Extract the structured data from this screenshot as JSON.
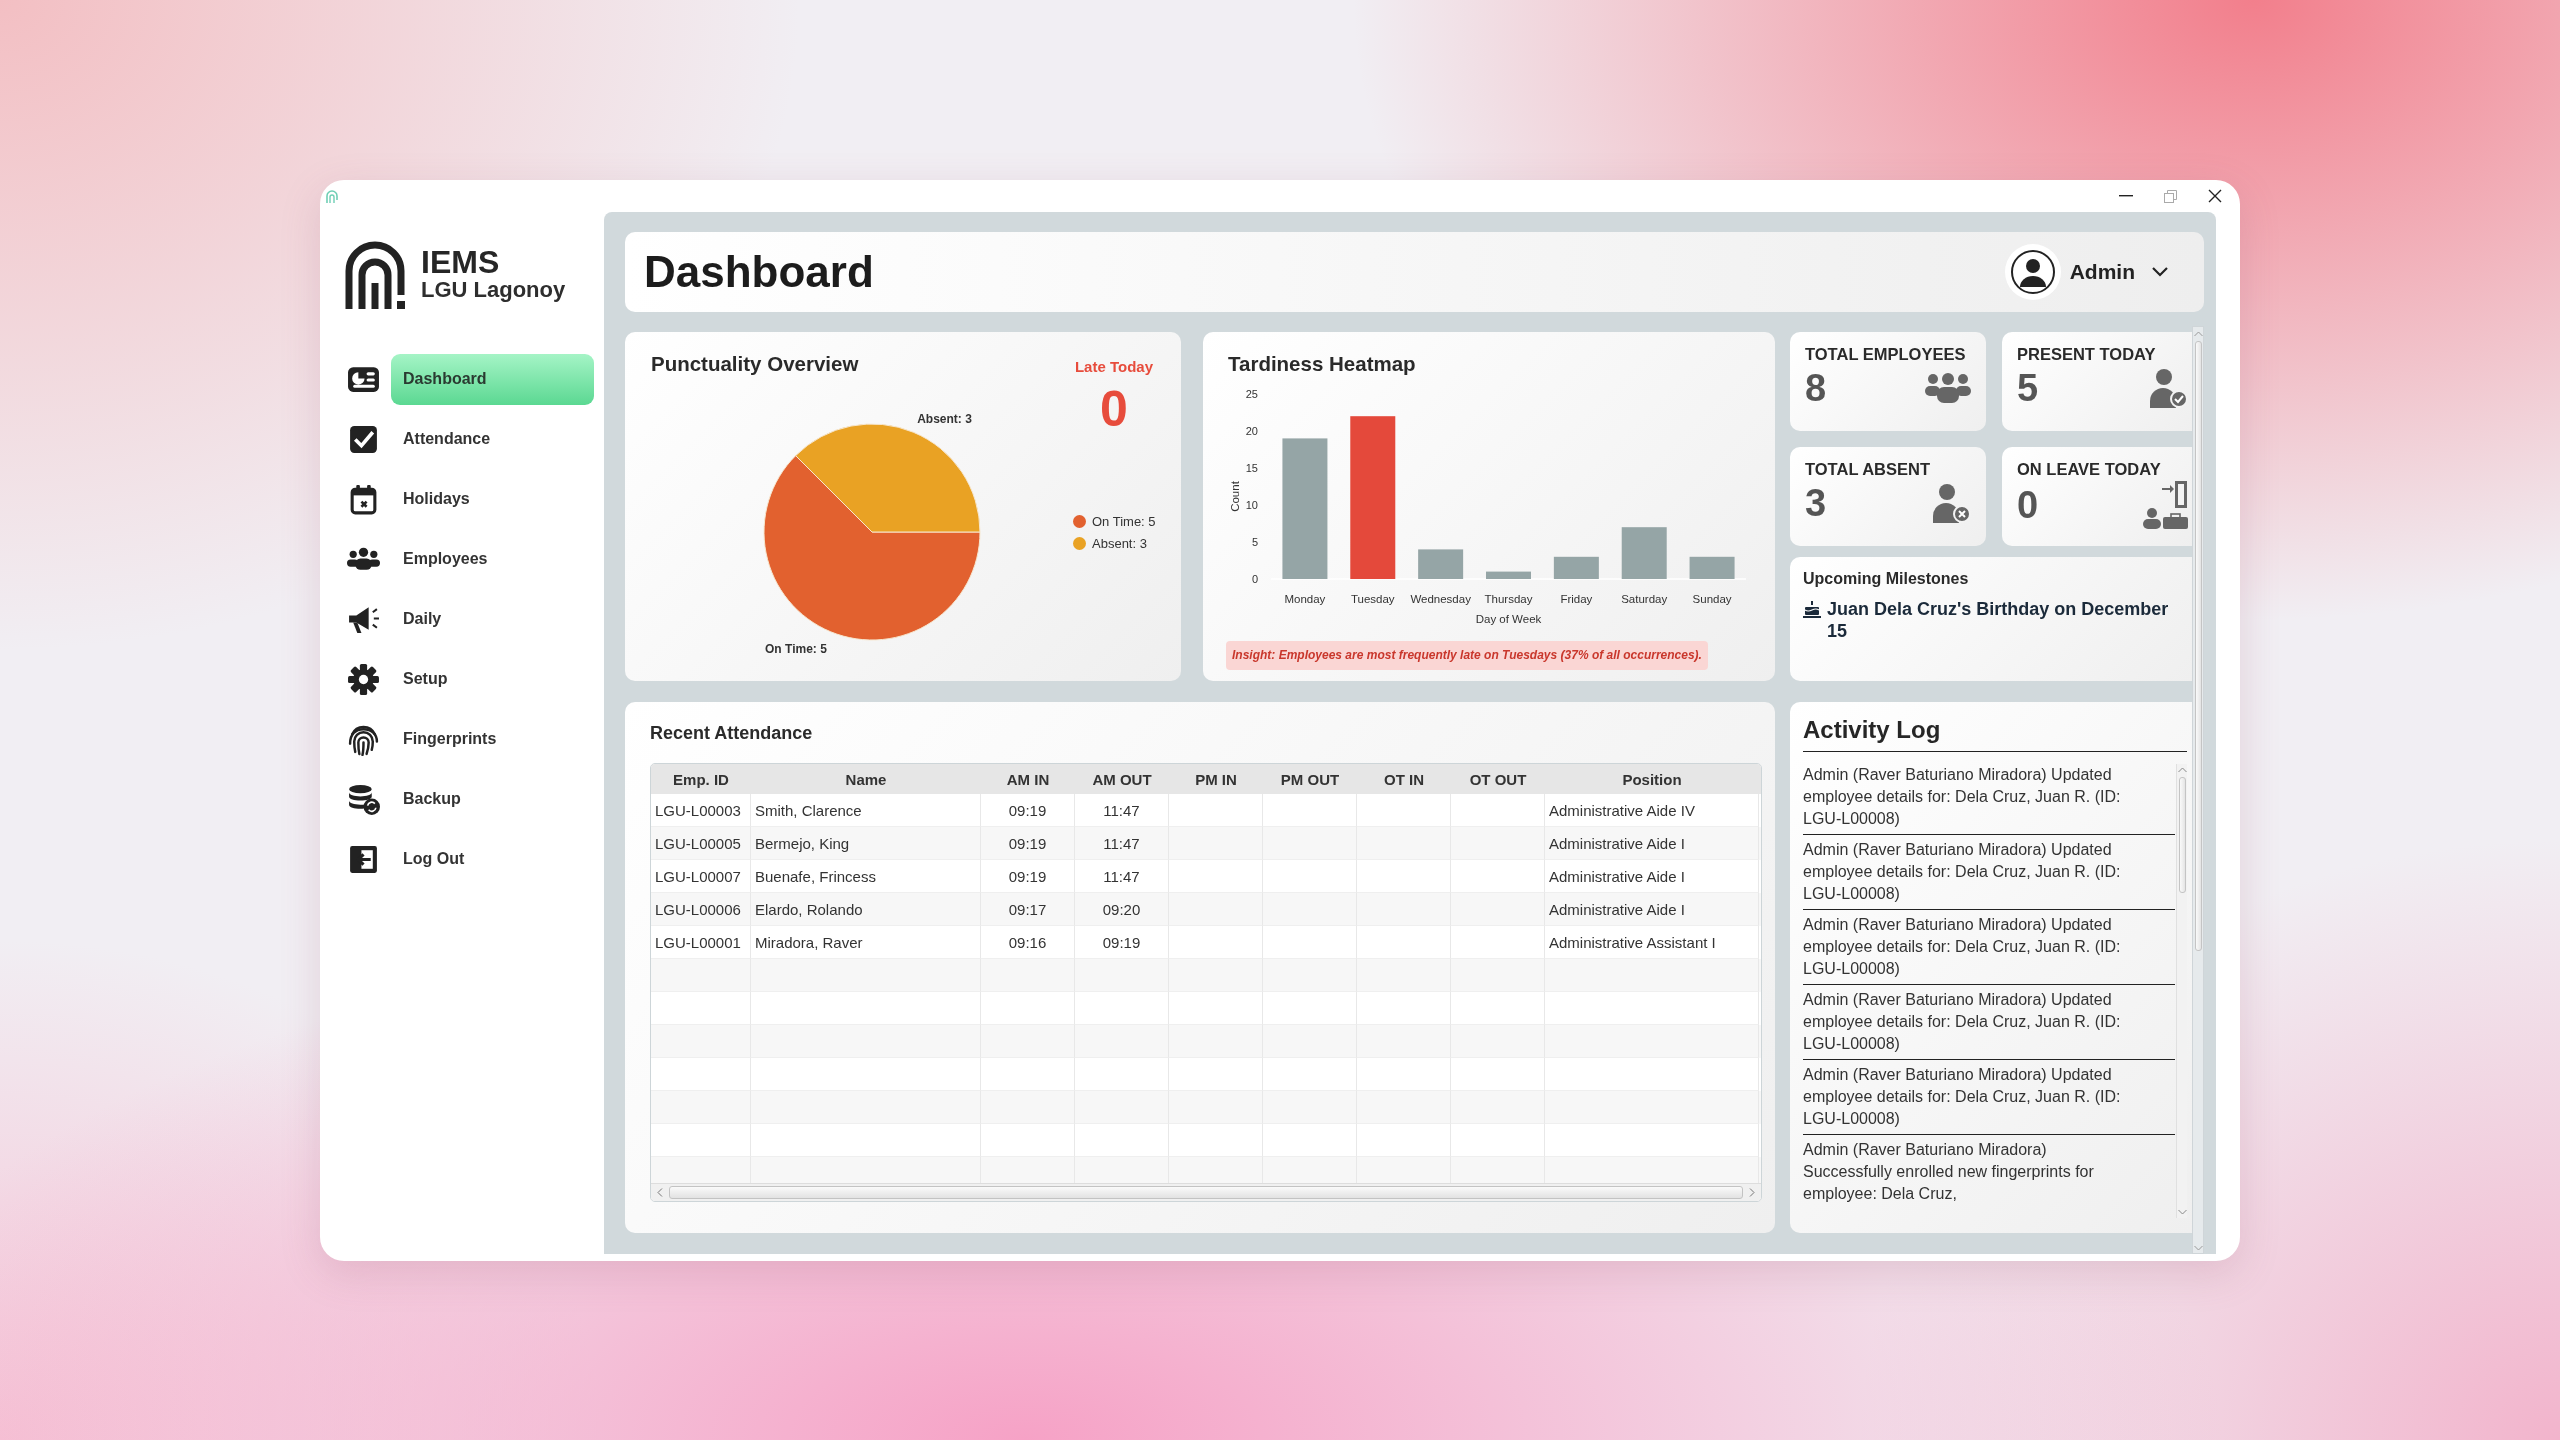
{
  "sidebar": {
    "brand": {
      "title": "IEMS",
      "subtitle": "LGU Lagonoy"
    },
    "items": [
      {
        "label": "Dashboard",
        "selected": true
      },
      {
        "label": "Attendance",
        "selected": false
      },
      {
        "label": "Holidays",
        "selected": false
      },
      {
        "label": "Employees",
        "selected": false
      },
      {
        "label": "Daily",
        "selected": false
      },
      {
        "label": "Setup",
        "selected": false
      },
      {
        "label": "Fingerprints",
        "selected": false
      },
      {
        "label": "Backup",
        "selected": false
      },
      {
        "label": "Log Out",
        "selected": false
      }
    ]
  },
  "header": {
    "title": "Dashboard",
    "user": {
      "name": "Admin"
    }
  },
  "punctuality": {
    "title": "Punctuality Overview",
    "late_today": {
      "label": "Late Today",
      "value": "0"
    },
    "chart_data": {
      "type": "pie",
      "values": [
        5,
        3
      ],
      "value_labels": [
        "On Time: 5",
        "Absent: 3"
      ]
    },
    "legend": [
      {
        "label": "On Time: 5",
        "color": "#e2612f"
      },
      {
        "label": "Absent: 3",
        "color": "#e9a224"
      }
    ]
  },
  "tardiness": {
    "chart_data": {
      "type": "bar",
      "title": "Tardiness Heatmap",
      "categories": [
        "Monday",
        "Tuesday",
        "Wednesday",
        "Thursday",
        "Friday",
        "Saturday",
        "Sunday"
      ],
      "series": [
        {
          "color": "#95a5a6",
          "values": [
            19,
            0,
            4,
            1,
            3,
            7,
            3
          ]
        },
        {
          "color": "#e4493b",
          "values": [
            0,
            22,
            0,
            0,
            0,
            0,
            0
          ]
        }
      ],
      "stacked": true,
      "xlabel": "Day of Week",
      "ylabel": "Count",
      "ylim": [
        0,
        25
      ],
      "yticks": [
        0,
        5,
        10,
        15,
        20,
        25
      ]
    },
    "insight": "Insight: Employees are most frequently late on Tuesdays (37% of all occurrences)."
  },
  "stats": [
    {
      "label": "TOTAL EMPLOYEES",
      "value": "8"
    },
    {
      "label": "PRESENT TODAY",
      "value": "5"
    },
    {
      "label": "TOTAL ABSENT",
      "value": "3"
    },
    {
      "label": "ON LEAVE TODAY",
      "value": "0"
    }
  ],
  "milestones": {
    "title": "Upcoming Milestones",
    "items": [
      "Juan Dela Cruz's Birthday on December 15"
    ]
  },
  "recent_attendance": {
    "title": "Recent Attendance",
    "columns": [
      "Emp. ID",
      "Name",
      "AM IN",
      "AM OUT",
      "PM IN",
      "PM OUT",
      "OT IN",
      "OT OUT",
      "Position"
    ],
    "rows": [
      {
        "emp_id": "LGU-L00003",
        "name": "Smith, Clarence",
        "am_in": "09:19",
        "am_out": "11:47",
        "position": "Administrative Aide IV"
      },
      {
        "emp_id": "LGU-L00005",
        "name": "Bermejo, King",
        "am_in": "09:19",
        "am_out": "11:47",
        "position": "Administrative Aide I"
      },
      {
        "emp_id": "LGU-L00007",
        "name": "Buenafe, Frincess",
        "am_in": "09:19",
        "am_out": "11:47",
        "position": "Administrative Aide I"
      },
      {
        "emp_id": "LGU-L00006",
        "name": "Elardo, Rolando",
        "am_in": "09:17",
        "am_out": "09:20",
        "position": "Administrative Aide I"
      },
      {
        "emp_id": "LGU-L00001",
        "name": "Miradora, Raver",
        "am_in": "09:16",
        "am_out": "09:19",
        "position": "Administrative Assistant I"
      }
    ]
  },
  "activity_log": {
    "title": "Activity Log",
    "entries": [
      "Admin (Raver Baturiano Miradora) Updated employee details for: Dela Cruz, Juan R. (ID: LGU-L00008)",
      "Admin (Raver Baturiano Miradora) Updated employee details for: Dela Cruz, Juan R. (ID: LGU-L00008)",
      "Admin (Raver Baturiano Miradora) Updated employee details for: Dela Cruz, Juan R. (ID: LGU-L00008)",
      "Admin (Raver Baturiano Miradora) Updated employee details for: Dela Cruz, Juan R. (ID: LGU-L00008)",
      "Admin (Raver Baturiano Miradora) Updated employee details for: Dela Cruz, Juan R. (ID: LGU-L00008)",
      "Admin (Raver Baturiano Miradora) Successfully enrolled new fingerprints for employee: Dela Cruz,"
    ]
  }
}
